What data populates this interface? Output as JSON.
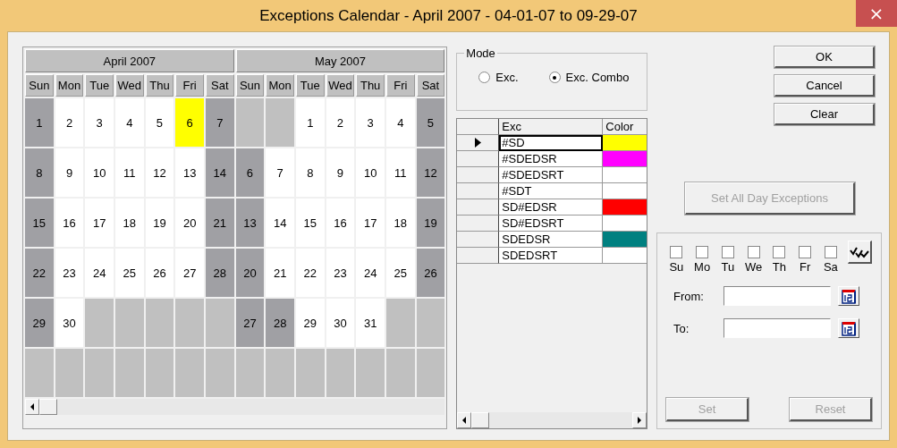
{
  "window": {
    "title": "Exceptions Calendar - April 2007 - 04-01-07 to 09-29-07",
    "close": "×"
  },
  "calendar": {
    "months": [
      {
        "title": "April 2007",
        "weekdays": [
          "Sun",
          "Mon",
          "Tue",
          "Wed",
          "Thu",
          "Fri",
          "Sat"
        ],
        "weeks": [
          [
            {
              "kind": "day",
              "day": "1",
              "off": true
            },
            {
              "kind": "day",
              "day": "2",
              "off": false
            },
            {
              "kind": "day",
              "day": "3",
              "off": false
            },
            {
              "kind": "day",
              "day": "4",
              "off": false
            },
            {
              "kind": "day",
              "day": "5",
              "off": false
            },
            {
              "kind": "day",
              "day": "6",
              "off": false,
              "color": "#ffff00"
            },
            {
              "kind": "day",
              "day": "7",
              "off": true
            }
          ],
          [
            {
              "kind": "day",
              "day": "8",
              "off": true
            },
            {
              "kind": "day",
              "day": "9",
              "off": false
            },
            {
              "kind": "day",
              "day": "10",
              "off": false
            },
            {
              "kind": "day",
              "day": "11",
              "off": false
            },
            {
              "kind": "day",
              "day": "12",
              "off": false
            },
            {
              "kind": "day",
              "day": "13",
              "off": false
            },
            {
              "kind": "day",
              "day": "14",
              "off": true
            }
          ],
          [
            {
              "kind": "day",
              "day": "15",
              "off": true
            },
            {
              "kind": "day",
              "day": "16",
              "off": false
            },
            {
              "kind": "day",
              "day": "17",
              "off": false
            },
            {
              "kind": "day",
              "day": "18",
              "off": false
            },
            {
              "kind": "day",
              "day": "19",
              "off": false
            },
            {
              "kind": "day",
              "day": "20",
              "off": false
            },
            {
              "kind": "day",
              "day": "21",
              "off": true
            }
          ],
          [
            {
              "kind": "day",
              "day": "22",
              "off": true
            },
            {
              "kind": "day",
              "day": "23",
              "off": false
            },
            {
              "kind": "day",
              "day": "24",
              "off": false
            },
            {
              "kind": "day",
              "day": "25",
              "off": false
            },
            {
              "kind": "day",
              "day": "26",
              "off": false
            },
            {
              "kind": "day",
              "day": "27",
              "off": false
            },
            {
              "kind": "day",
              "day": "28",
              "off": true
            }
          ],
          [
            {
              "kind": "day",
              "day": "29",
              "off": true
            },
            {
              "kind": "day",
              "day": "30",
              "off": false
            },
            {
              "kind": "blank"
            },
            {
              "kind": "blank"
            },
            {
              "kind": "blank"
            },
            {
              "kind": "blank"
            },
            {
              "kind": "blank"
            }
          ],
          [
            {
              "kind": "blank"
            },
            {
              "kind": "blank"
            },
            {
              "kind": "blank"
            },
            {
              "kind": "blank"
            },
            {
              "kind": "blank"
            },
            {
              "kind": "blank"
            },
            {
              "kind": "blank"
            }
          ]
        ]
      },
      {
        "title": "May 2007",
        "weekdays": [
          "Sun",
          "Mon",
          "Tue",
          "Wed",
          "Thu",
          "Fri",
          "Sat"
        ],
        "weeks": [
          [
            {
              "kind": "blank"
            },
            {
              "kind": "blank"
            },
            {
              "kind": "day",
              "day": "1",
              "off": false
            },
            {
              "kind": "day",
              "day": "2",
              "off": false
            },
            {
              "kind": "day",
              "day": "3",
              "off": false
            },
            {
              "kind": "day",
              "day": "4",
              "off": false
            },
            {
              "kind": "day",
              "day": "5",
              "off": true
            }
          ],
          [
            {
              "kind": "day",
              "day": "6",
              "off": true
            },
            {
              "kind": "day",
              "day": "7",
              "off": false
            },
            {
              "kind": "day",
              "day": "8",
              "off": false
            },
            {
              "kind": "day",
              "day": "9",
              "off": false
            },
            {
              "kind": "day",
              "day": "10",
              "off": false
            },
            {
              "kind": "day",
              "day": "11",
              "off": false
            },
            {
              "kind": "day",
              "day": "12",
              "off": true
            }
          ],
          [
            {
              "kind": "day",
              "day": "13",
              "off": true
            },
            {
              "kind": "day",
              "day": "14",
              "off": false
            },
            {
              "kind": "day",
              "day": "15",
              "off": false
            },
            {
              "kind": "day",
              "day": "16",
              "off": false
            },
            {
              "kind": "day",
              "day": "17",
              "off": false
            },
            {
              "kind": "day",
              "day": "18",
              "off": false
            },
            {
              "kind": "day",
              "day": "19",
              "off": true
            }
          ],
          [
            {
              "kind": "day",
              "day": "20",
              "off": true
            },
            {
              "kind": "day",
              "day": "21",
              "off": false
            },
            {
              "kind": "day",
              "day": "22",
              "off": false
            },
            {
              "kind": "day",
              "day": "23",
              "off": false
            },
            {
              "kind": "day",
              "day": "24",
              "off": false
            },
            {
              "kind": "day",
              "day": "25",
              "off": false
            },
            {
              "kind": "day",
              "day": "26",
              "off": true
            }
          ],
          [
            {
              "kind": "day",
              "day": "27",
              "off": true
            },
            {
              "kind": "day",
              "day": "28",
              "off": true
            },
            {
              "kind": "day",
              "day": "29",
              "off": false
            },
            {
              "kind": "day",
              "day": "30",
              "off": false
            },
            {
              "kind": "day",
              "day": "31",
              "off": false
            },
            {
              "kind": "blank"
            },
            {
              "kind": "blank"
            }
          ],
          [
            {
              "kind": "blank"
            },
            {
              "kind": "blank"
            },
            {
              "kind": "blank"
            },
            {
              "kind": "blank"
            },
            {
              "kind": "blank"
            },
            {
              "kind": "blank"
            },
            {
              "kind": "blank"
            }
          ]
        ]
      }
    ]
  },
  "mode": {
    "title": "Mode",
    "options": [
      {
        "label": "Exc.",
        "selected": false
      },
      {
        "label": "Exc. Combo",
        "selected": true
      }
    ]
  },
  "exceptions": {
    "columns": [
      "Exc",
      "Color"
    ],
    "rows": [
      {
        "name": "#SD",
        "selected": true,
        "color": "#ffff00"
      },
      {
        "name": "#SDEDSR",
        "selected": false,
        "color": "#ff00ff"
      },
      {
        "name": "#SDEDSRT",
        "selected": false,
        "color": "#ffffff"
      },
      {
        "name": "#SDT",
        "selected": false,
        "color": "#ffffff"
      },
      {
        "name": "SD#EDSR",
        "selected": false,
        "color": "#ff0000"
      },
      {
        "name": "SD#EDSRT",
        "selected": false,
        "color": "#ffffff"
      },
      {
        "name": "SDEDSR",
        "selected": false,
        "color": "#008080"
      },
      {
        "name": "SDEDSRT",
        "selected": false,
        "color": "#ffffff"
      }
    ]
  },
  "buttons": [
    {
      "label": "OK"
    },
    {
      "label": "Cancel"
    },
    {
      "label": "Clear"
    }
  ],
  "set_all_button": {
    "label": "Set All Day Exceptions",
    "disabled": true
  },
  "days": [
    {
      "label": "Su",
      "checked": false
    },
    {
      "label": "Mo",
      "checked": false
    },
    {
      "label": "Tu",
      "checked": false
    },
    {
      "label": "We",
      "checked": false
    },
    {
      "label": "Th",
      "checked": false
    },
    {
      "label": "Fr",
      "checked": false
    },
    {
      "label": "Sa",
      "checked": false
    }
  ],
  "from": {
    "label": "From:"
  },
  "to": {
    "label": "To:"
  },
  "actions": [
    {
      "label": "Set",
      "disabled": true
    },
    {
      "label": "Reset",
      "disabled": true
    }
  ]
}
